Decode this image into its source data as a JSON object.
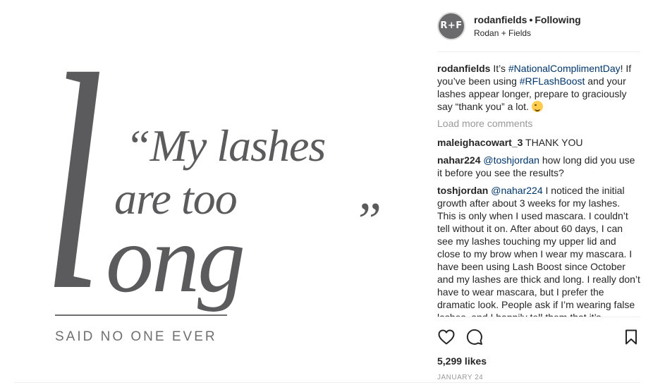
{
  "image": {
    "big_l": "l",
    "line1": "“My lashes",
    "line2": "are too",
    "line3": "ong",
    "close_quote": "”",
    "tagline": "SAID NO ONE EVER"
  },
  "header": {
    "avatar_text": "R+F",
    "username": "rodanfields",
    "separator": "•",
    "follow_status": "Following",
    "subtitle": "Rodan + Fields"
  },
  "caption": {
    "user": "rodanfields",
    "text_1": " It’s ",
    "tag_1": "#NationalComplimentDay",
    "text_2": "! If you’ve been using ",
    "tag_2": "#RFLashBoost",
    "text_3": " and your lashes appear longer, prepare to graciously say “thank you” a lot. ",
    "emoji": "winking-face"
  },
  "load_more": "Load more comments",
  "comments": [
    {
      "user": "maleighacowart_3",
      "mention": "",
      "text": " THANK YOU"
    },
    {
      "user": "nahar224",
      "mention": "@toshjordan",
      "text": " how long did you use it before you see the results?"
    },
    {
      "user": "toshjordan",
      "mention": "@nahar224",
      "text": " I noticed the initial growth after about 3 weeks for my lashes. This is only when I used mascara. I couldn’t tell without it on. After about 60 days, I can see my lashes touching my upper lid and close to my brow when I wear my mascara. I have been using Lash Boost since October and my lashes are thick and long. I really don’t have to wear mascara, but I prefer the dramatic look. People ask if I’m wearing false lashes, and I happily tell them that it’s"
    }
  ],
  "actions": {
    "like_icon": "heart-icon",
    "comment_icon": "comment-icon",
    "save_icon": "bookmark-icon"
  },
  "likes": "5,299 likes",
  "date": "JANUARY 24",
  "colors": {
    "link": "#003569",
    "muted": "#999999",
    "text": "#262626",
    "image_gray": "#5b5b5d"
  }
}
